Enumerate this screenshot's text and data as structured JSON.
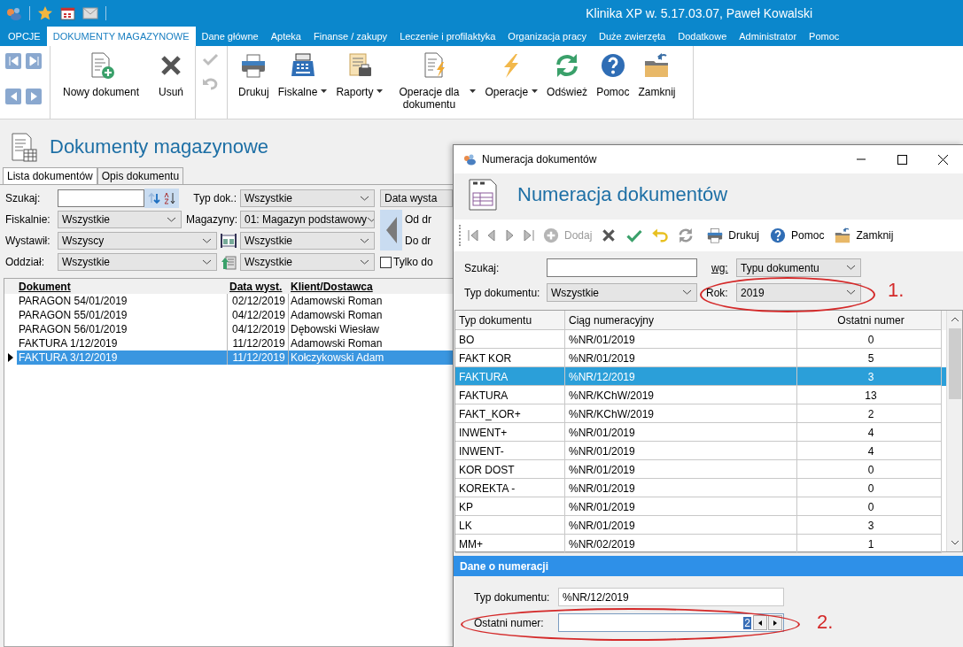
{
  "app": {
    "title": "Klinika XP w. 5.17.03.07, Paweł Kowalski"
  },
  "ribbon_tabs": [
    {
      "label": "OPCJE",
      "selected": false
    },
    {
      "label": "DOKUMENTY MAGAZYNOWE",
      "selected": true
    },
    {
      "label": "Dane główne",
      "selected": false
    },
    {
      "label": "Apteka",
      "selected": false
    },
    {
      "label": "Finanse / zakupy",
      "selected": false
    },
    {
      "label": "Leczenie i profilaktyka",
      "selected": false
    },
    {
      "label": "Organizacja pracy",
      "selected": false
    },
    {
      "label": "Duże zwierzęta",
      "selected": false
    },
    {
      "label": "Dodatkowe",
      "selected": false
    },
    {
      "label": "Administrator",
      "selected": false
    },
    {
      "label": "Pomoc",
      "selected": false
    }
  ],
  "ribbon": {
    "document_actions": [
      {
        "label": "Nowy dokument",
        "dropdown": false
      },
      {
        "label": "Usuń",
        "dropdown": false
      }
    ],
    "edit_actions": [
      {
        "disabled": true
      },
      {
        "disabled": true
      }
    ],
    "tools": [
      {
        "label": "Drukuj",
        "dropdown": false
      },
      {
        "label": "Fiskalne",
        "dropdown": true
      },
      {
        "label": "Raporty",
        "dropdown": true
      },
      {
        "label": "Operacje dla dokumentu",
        "dropdown": true
      },
      {
        "label": "Operacje",
        "dropdown": true
      },
      {
        "label": "Odśwież",
        "dropdown": false
      },
      {
        "label": "Pomoc",
        "dropdown": false
      },
      {
        "label": "Zamknij",
        "dropdown": false
      }
    ]
  },
  "page": {
    "title": "Dokumenty magazynowe",
    "tabs": [
      {
        "label": "Lista dokumentów",
        "selected": true
      },
      {
        "label": "Opis dokumentu",
        "selected": false
      }
    ],
    "filters": {
      "search_label": "Szukaj:",
      "doc_type": {
        "label": "Typ dok.:",
        "value": "Wszystkie"
      },
      "date_kind": "Data wysta",
      "fiscal": {
        "label": "Fiskalnie:",
        "value": "Wszystkie"
      },
      "stores": {
        "label": "Magazyny:",
        "value": "01: Magazyn podstawowy"
      },
      "date_from": "Od dr",
      "issuer": {
        "label": "Wystawił:",
        "value": "Wszyscy"
      },
      "category": "Wszystkie",
      "date_to": "Do dr",
      "branch": {
        "label": "Oddział:",
        "value": "Wszystkie"
      },
      "origin": "Wszystkie",
      "only": {
        "label": "Tylko do",
        "checked": false
      }
    },
    "table": {
      "columns": [
        "Dokument",
        "Data wyst.",
        "Klient/Dostawca"
      ],
      "rows": [
        {
          "cells": [
            "PARAGON 54/01/2019",
            "02/12/2019",
            "Adamowski Roman"
          ],
          "selected": false
        },
        {
          "cells": [
            "PARAGON 55/01/2019",
            "04/12/2019",
            "Adamowski Roman"
          ],
          "selected": false
        },
        {
          "cells": [
            "PARAGON 56/01/2019",
            "04/12/2019",
            "Dębowski Wiesław"
          ],
          "selected": false
        },
        {
          "cells": [
            "FAKTURA 1/12/2019",
            "11/12/2019",
            "Adamowski Roman"
          ],
          "selected": false
        },
        {
          "cells": [
            "FAKTURA 3/12/2019",
            "11/12/2019",
            "Kołczykowski Adam"
          ],
          "selected": true
        }
      ]
    }
  },
  "dialog": {
    "title": "Numeracja dokumentów",
    "heading": "Numeracja dokumentów",
    "toolbar": {
      "add": {
        "label": "Dodaj",
        "disabled": true
      },
      "print": {
        "label": "Drukuj"
      },
      "help": {
        "label": "Pomoc"
      },
      "close": {
        "label": "Zamknij"
      }
    },
    "filters": {
      "search_label": "Szukaj:",
      "by": {
        "label": "wg:",
        "value": "Typu dokumentu"
      },
      "doc_type": {
        "label": "Typ dokumentu:",
        "value": "Wszystkie"
      },
      "year": {
        "label": "Rok:",
        "value": "2019"
      }
    },
    "annotation_1": "1.",
    "table": {
      "columns": [
        "Typ dokumentu",
        "Ciąg numeracyjny",
        "Ostatni numer"
      ],
      "rows": [
        {
          "cells": [
            "BO",
            "%NR/01/2019",
            "0"
          ],
          "selected": false
        },
        {
          "cells": [
            "FAKT KOR",
            "%NR/01/2019",
            "5"
          ],
          "selected": false
        },
        {
          "cells": [
            "FAKTURA",
            "%NR/12/2019",
            "3"
          ],
          "selected": true
        },
        {
          "cells": [
            "FAKTURA",
            "%NR/KChW/2019",
            "13"
          ],
          "selected": false
        },
        {
          "cells": [
            "FAKT_KOR+",
            "%NR/KChW/2019",
            "2"
          ],
          "selected": false
        },
        {
          "cells": [
            "INWENT+",
            "%NR/01/2019",
            "4"
          ],
          "selected": false
        },
        {
          "cells": [
            "INWENT-",
            "%NR/01/2019",
            "4"
          ],
          "selected": false
        },
        {
          "cells": [
            "KOR DOST",
            "%NR/01/2019",
            "0"
          ],
          "selected": false
        },
        {
          "cells": [
            "KOREKTA -",
            "%NR/01/2019",
            "0"
          ],
          "selected": false
        },
        {
          "cells": [
            "KP",
            "%NR/01/2019",
            "0"
          ],
          "selected": false
        },
        {
          "cells": [
            "LK",
            "%NR/01/2019",
            "3"
          ],
          "selected": false
        },
        {
          "cells": [
            "MM+",
            "%NR/02/2019",
            "1"
          ],
          "selected": false
        }
      ]
    },
    "details": {
      "header": "Dane o numeracji",
      "doc_type": {
        "label": "Typ dokumentu:",
        "value": "%NR/12/2019"
      },
      "last_number": {
        "label": "Ostatni numer:",
        "value": "2"
      }
    },
    "annotation_2": "2."
  }
}
